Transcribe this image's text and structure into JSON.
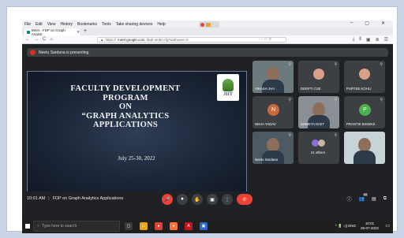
{
  "browser": {
    "menu": [
      "File",
      "Edit",
      "View",
      "History",
      "Bookmarks",
      "Tools",
      "Take sharing devices",
      "Help"
    ],
    "window_controls": [
      "–",
      "▢",
      "✕"
    ],
    "tab_title": "Meet - FDP on Graph Analyti",
    "tab_close": "✕",
    "new_tab": "+",
    "nav": [
      "←",
      "→",
      "C",
      "⌂"
    ],
    "url_domain": "meet.google.com",
    "url_prefix": "https://",
    "url_suffix": "/bah-xmbn-rfg?authuser=0",
    "url_icons": "··· ☆ ✩",
    "right_nav": [
      "⤓",
      "⫴",
      "▣",
      "⊕",
      "☰"
    ]
  },
  "meet": {
    "banner": "Neetu Sardana is presenting",
    "slide": {
      "title_lines": [
        "FACULTY DEVELOPMENT",
        "PROGRAM",
        "ON",
        "“GRAPH ANALYTICS",
        "APPLICATIONS"
      ],
      "date": "July 25-30, 2022",
      "logo_text": "JIIT"
    },
    "participants": [
      {
        "name": "VIKASH JHA",
        "type": "video",
        "bg": "#6c7a7d"
      },
      {
        "name": "DEEPTI CSE",
        "type": "avatar-photo",
        "bg": "#3c4043"
      },
      {
        "name": "PURTEE KOHLI",
        "type": "avatar-photo",
        "bg": "#3c4043"
      },
      {
        "name": "NEHA YADAV",
        "type": "letter",
        "letter": "N",
        "bg": "#3c4043",
        "color": "#c96a3a"
      },
      {
        "name": "SHWETA DIXIT",
        "type": "video",
        "bg": "#8a8f96"
      },
      {
        "name": "PRANTIK BISWAS",
        "type": "letter",
        "letter": "P",
        "bg": "#3c4043",
        "color": "#4caf50"
      },
      {
        "name": "Neetu Sardana",
        "type": "video",
        "bg": "#4e5a63"
      },
      {
        "name": "21 others",
        "type": "others",
        "bg": "#3c4043"
      },
      {
        "name": "",
        "type": "video",
        "bg": "#c8d3d8"
      }
    ],
    "time": "10:01 AM",
    "separator": "|",
    "meeting_name": "FDP on Graph Analytics Applications",
    "controls": [
      "🎤",
      "⏺",
      "✋",
      "▣",
      "⋮"
    ],
    "end_icon": "✆",
    "right_controls": [
      "ⓘ",
      "👥",
      "▤",
      "⧉"
    ],
    "people_count": "26"
  },
  "taskbar": {
    "search_placeholder": "Type here to search",
    "apps": [
      {
        "name": "task-view",
        "glyph": "▢",
        "color": "#3a3a3a"
      },
      {
        "name": "file-explorer",
        "glyph": "▭",
        "color": "#e8a317"
      },
      {
        "name": "chrome",
        "glyph": "●",
        "color": "#db4437"
      },
      {
        "name": "firefox",
        "glyph": "●",
        "color": "#ff7139"
      },
      {
        "name": "acrobat",
        "glyph": "A",
        "color": "#c4161c"
      },
      {
        "name": "photos",
        "glyph": "▣",
        "color": "#2d68c4"
      }
    ],
    "tray_icons": "^ 🔋 ◁) ENG",
    "clock_time": "10:01",
    "clock_date": "25-07-2022",
    "notif": "▭"
  }
}
